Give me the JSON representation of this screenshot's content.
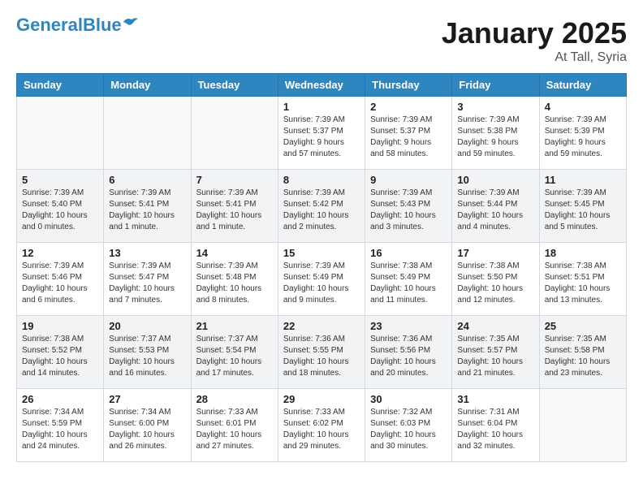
{
  "logo": {
    "part1": "General",
    "part2": "Blue"
  },
  "title": "January 2025",
  "location": "At Tall, Syria",
  "weekdays": [
    "Sunday",
    "Monday",
    "Tuesday",
    "Wednesday",
    "Thursday",
    "Friday",
    "Saturday"
  ],
  "weeks": [
    [
      {
        "day": "",
        "info": ""
      },
      {
        "day": "",
        "info": ""
      },
      {
        "day": "",
        "info": ""
      },
      {
        "day": "1",
        "info": "Sunrise: 7:39 AM\nSunset: 5:37 PM\nDaylight: 9 hours\nand 57 minutes."
      },
      {
        "day": "2",
        "info": "Sunrise: 7:39 AM\nSunset: 5:37 PM\nDaylight: 9 hours\nand 58 minutes."
      },
      {
        "day": "3",
        "info": "Sunrise: 7:39 AM\nSunset: 5:38 PM\nDaylight: 9 hours\nand 59 minutes."
      },
      {
        "day": "4",
        "info": "Sunrise: 7:39 AM\nSunset: 5:39 PM\nDaylight: 9 hours\nand 59 minutes."
      }
    ],
    [
      {
        "day": "5",
        "info": "Sunrise: 7:39 AM\nSunset: 5:40 PM\nDaylight: 10 hours\nand 0 minutes."
      },
      {
        "day": "6",
        "info": "Sunrise: 7:39 AM\nSunset: 5:41 PM\nDaylight: 10 hours\nand 1 minute."
      },
      {
        "day": "7",
        "info": "Sunrise: 7:39 AM\nSunset: 5:41 PM\nDaylight: 10 hours\nand 1 minute."
      },
      {
        "day": "8",
        "info": "Sunrise: 7:39 AM\nSunset: 5:42 PM\nDaylight: 10 hours\nand 2 minutes."
      },
      {
        "day": "9",
        "info": "Sunrise: 7:39 AM\nSunset: 5:43 PM\nDaylight: 10 hours\nand 3 minutes."
      },
      {
        "day": "10",
        "info": "Sunrise: 7:39 AM\nSunset: 5:44 PM\nDaylight: 10 hours\nand 4 minutes."
      },
      {
        "day": "11",
        "info": "Sunrise: 7:39 AM\nSunset: 5:45 PM\nDaylight: 10 hours\nand 5 minutes."
      }
    ],
    [
      {
        "day": "12",
        "info": "Sunrise: 7:39 AM\nSunset: 5:46 PM\nDaylight: 10 hours\nand 6 minutes."
      },
      {
        "day": "13",
        "info": "Sunrise: 7:39 AM\nSunset: 5:47 PM\nDaylight: 10 hours\nand 7 minutes."
      },
      {
        "day": "14",
        "info": "Sunrise: 7:39 AM\nSunset: 5:48 PM\nDaylight: 10 hours\nand 8 minutes."
      },
      {
        "day": "15",
        "info": "Sunrise: 7:39 AM\nSunset: 5:49 PM\nDaylight: 10 hours\nand 9 minutes."
      },
      {
        "day": "16",
        "info": "Sunrise: 7:38 AM\nSunset: 5:49 PM\nDaylight: 10 hours\nand 11 minutes."
      },
      {
        "day": "17",
        "info": "Sunrise: 7:38 AM\nSunset: 5:50 PM\nDaylight: 10 hours\nand 12 minutes."
      },
      {
        "day": "18",
        "info": "Sunrise: 7:38 AM\nSunset: 5:51 PM\nDaylight: 10 hours\nand 13 minutes."
      }
    ],
    [
      {
        "day": "19",
        "info": "Sunrise: 7:38 AM\nSunset: 5:52 PM\nDaylight: 10 hours\nand 14 minutes."
      },
      {
        "day": "20",
        "info": "Sunrise: 7:37 AM\nSunset: 5:53 PM\nDaylight: 10 hours\nand 16 minutes."
      },
      {
        "day": "21",
        "info": "Sunrise: 7:37 AM\nSunset: 5:54 PM\nDaylight: 10 hours\nand 17 minutes."
      },
      {
        "day": "22",
        "info": "Sunrise: 7:36 AM\nSunset: 5:55 PM\nDaylight: 10 hours\nand 18 minutes."
      },
      {
        "day": "23",
        "info": "Sunrise: 7:36 AM\nSunset: 5:56 PM\nDaylight: 10 hours\nand 20 minutes."
      },
      {
        "day": "24",
        "info": "Sunrise: 7:35 AM\nSunset: 5:57 PM\nDaylight: 10 hours\nand 21 minutes."
      },
      {
        "day": "25",
        "info": "Sunrise: 7:35 AM\nSunset: 5:58 PM\nDaylight: 10 hours\nand 23 minutes."
      }
    ],
    [
      {
        "day": "26",
        "info": "Sunrise: 7:34 AM\nSunset: 5:59 PM\nDaylight: 10 hours\nand 24 minutes."
      },
      {
        "day": "27",
        "info": "Sunrise: 7:34 AM\nSunset: 6:00 PM\nDaylight: 10 hours\nand 26 minutes."
      },
      {
        "day": "28",
        "info": "Sunrise: 7:33 AM\nSunset: 6:01 PM\nDaylight: 10 hours\nand 27 minutes."
      },
      {
        "day": "29",
        "info": "Sunrise: 7:33 AM\nSunset: 6:02 PM\nDaylight: 10 hours\nand 29 minutes."
      },
      {
        "day": "30",
        "info": "Sunrise: 7:32 AM\nSunset: 6:03 PM\nDaylight: 10 hours\nand 30 minutes."
      },
      {
        "day": "31",
        "info": "Sunrise: 7:31 AM\nSunset: 6:04 PM\nDaylight: 10 hours\nand 32 minutes."
      },
      {
        "day": "",
        "info": ""
      }
    ]
  ]
}
